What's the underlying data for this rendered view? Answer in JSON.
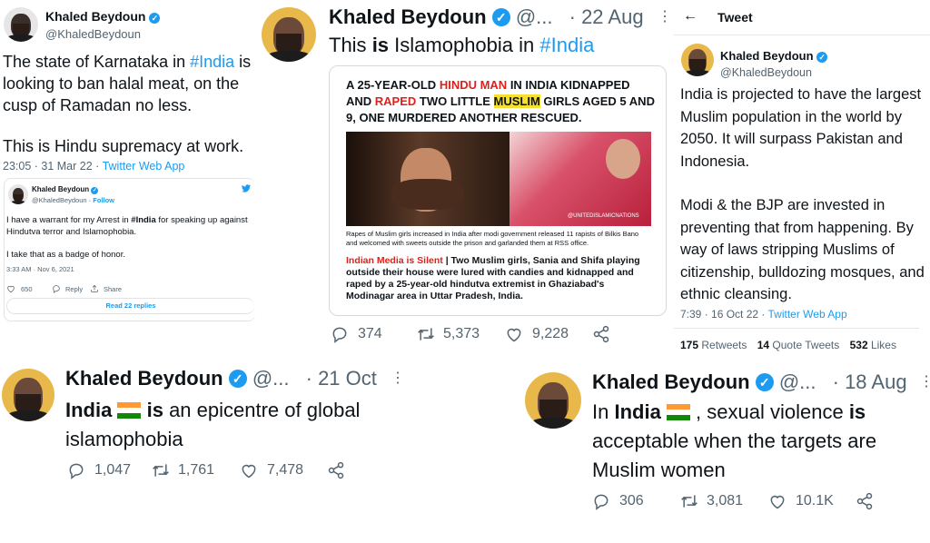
{
  "tweet1": {
    "name": "Khaled Beydoun",
    "handle": "@KhaledBeydoun",
    "text_a": "The state of Karnataka in ",
    "hashtag": "#India",
    "text_b": " is looking to ban halal meat, on the cusp of Ramadan no less.",
    "text_c": "This is Hindu supremacy at work.",
    "time": "23:05 · 31 Mar 22 · ",
    "source": "Twitter Web App",
    "quoted": {
      "name": "Khaled Beydoun",
      "handle": "@KhaledBeydoun",
      "follow": "Follow",
      "text_a": "I have a warrant for my Arrest in ",
      "hashtag": "#India",
      "text_b": " for speaking up against Hindutva terror and Islamophobia.",
      "text_c": "I take that as a badge of honor.",
      "time": "3:33 AM · Nov 6, 2021",
      "likes": "650",
      "reply": "Reply",
      "share": "Share",
      "read_replies": "Read 22 replies"
    }
  },
  "tweet2": {
    "name": "Khaled Beydoun",
    "handle": "@...",
    "date": "· 22 Aug",
    "text_a": "This ",
    "text_bold": "is",
    "text_b": " Islamophobia in ",
    "hashtag": "#India",
    "image": {
      "headline_1": "A 25-YEAR-OLD ",
      "headline_red1": "HINDU MAN",
      "headline_2": " IN INDIA KIDNAPPED AND ",
      "headline_red2": "RAPED",
      "headline_3": " TWO LITTLE ",
      "headline_hl": "MUSLIM",
      "headline_4": " GIRLS AGED 5 AND 9, ONE MURDERED ANOTHER RESCUED.",
      "watermark": "@UNITEDISLAMICNATIONS",
      "caption": "Rapes of Muslim girls increased in India after modi government released 11 rapists of Bilkis Bano and welcomed with sweets outside the prison and garlanded them at RSS office.",
      "silent": "Indian Media is Silent",
      "body": " | Two Muslim girls, Sania and Shifa playing outside their house were lured with candies and kidnapped and raped by a 25-year-old hindutva extremist in Ghaziabad's Modinagar area in Uttar Pradesh, India."
    },
    "replies": "374",
    "retweets": "5,373",
    "likes": "9,228"
  },
  "tweet3": {
    "header": "Tweet",
    "name": "Khaled Beydoun",
    "handle": "@KhaledBeydoun",
    "text_a": "India is projected to have the largest Muslim population in the world by 2050.  It will surpass Pakistan and Indonesia.",
    "text_b": "Modi & the BJP are invested in preventing that from happening. By way of laws stripping Muslims of citizenship, bulldozing mosques, and ethnic cleansing.",
    "time": "7:39 · 16 Oct 22 · ",
    "source": "Twitter Web App",
    "retweets_n": "175",
    "retweets_l": " Retweets",
    "quotes_n": "14",
    "quotes_l": " Quote Tweets",
    "likes_n": "532",
    "likes_l": " Likes"
  },
  "tweet4": {
    "name": "Khaled Beydoun",
    "handle": "@...",
    "date": "· 21 Oct",
    "india": "India",
    "is": "is",
    "text": " an epicentre of global islamophobia",
    "replies": "1,047",
    "retweets": "1,761",
    "likes": "7,478"
  },
  "tweet5": {
    "name": "Khaled Beydoun",
    "handle": "@...",
    "date": "· 18 Aug",
    "in": "In ",
    "india": "India",
    "text_a": " , sexual violence ",
    "is": "is",
    "text_b": " acceptable when the targets are Muslim women",
    "replies": "306",
    "retweets": "3,081",
    "likes": "10.1K"
  },
  "colors": {
    "link": "#1d9bf0",
    "muted": "#536471",
    "red": "#e0201a",
    "highlight": "#f5e030"
  },
  "icons": [
    "verified-badge-icon",
    "reply-icon",
    "retweet-icon",
    "like-icon",
    "share-icon",
    "back-arrow-icon",
    "more-icon",
    "twitter-logo-icon",
    "india-flag-icon"
  ]
}
